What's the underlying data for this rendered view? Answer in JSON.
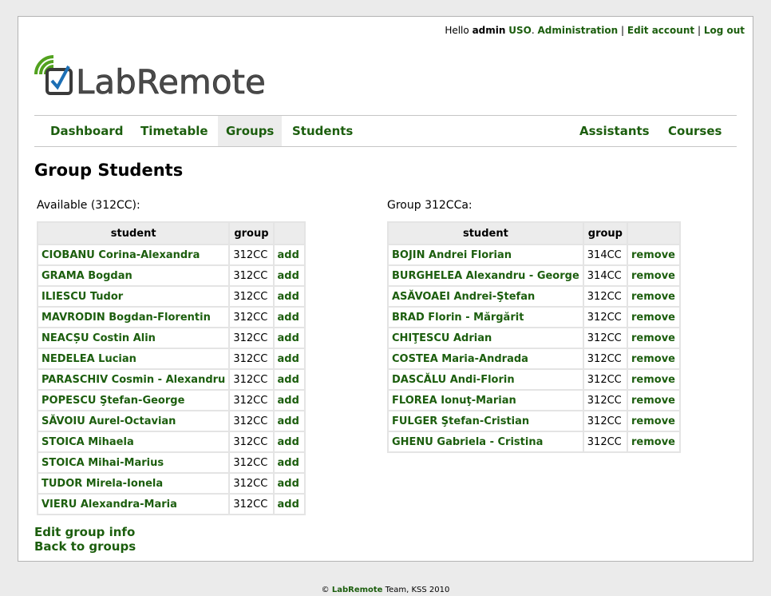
{
  "userbar": {
    "hello": "Hello",
    "username": "admin",
    "role": "USO",
    "admin_link": "Administration",
    "edit_link": "Edit account",
    "logout_link": "Log out"
  },
  "logo": {
    "text": "LabRemote"
  },
  "nav": {
    "left": [
      "Dashboard",
      "Timetable",
      "Groups",
      "Students"
    ],
    "right": [
      "Assistants",
      "Courses"
    ],
    "active": "Groups"
  },
  "page": {
    "title": "Group Students"
  },
  "available": {
    "caption": "Available (312CC):",
    "headers": [
      "student",
      "group"
    ],
    "action": "add",
    "rows": [
      [
        "CIOBANU Corina-Alexandra",
        "312CC"
      ],
      [
        "GRAMA Bogdan",
        "312CC"
      ],
      [
        "ILIESCU Tudor",
        "312CC"
      ],
      [
        "MAVRODIN Bogdan-Florentin",
        "312CC"
      ],
      [
        "NEACȘU Costin Alin",
        "312CC"
      ],
      [
        "NEDELEA Lucian",
        "312CC"
      ],
      [
        "PARASCHIV Cosmin - Alexandru",
        "312CC"
      ],
      [
        "POPESCU Ştefan-George",
        "312CC"
      ],
      [
        "SĂVOIU Aurel-Octavian",
        "312CC"
      ],
      [
        "STOICA Mihaela",
        "312CC"
      ],
      [
        "STOICA Mihai-Marius",
        "312CC"
      ],
      [
        "TUDOR Mirela-Ionela",
        "312CC"
      ],
      [
        "VIERU Alexandra-Maria",
        "312CC"
      ]
    ]
  },
  "group": {
    "caption": "Group 312CCa:",
    "headers": [
      "student",
      "group"
    ],
    "action": "remove",
    "rows": [
      [
        "BOJIN Andrei Florian",
        "314CC"
      ],
      [
        "BURGHELEA Alexandru - George",
        "314CC"
      ],
      [
        "ASĂVOAEI Andrei-Ştefan",
        "312CC"
      ],
      [
        "BRAD Florin - Mărgărit",
        "312CC"
      ],
      [
        "CHIŢESCU Adrian",
        "312CC"
      ],
      [
        "COSTEA Maria-Andrada",
        "312CC"
      ],
      [
        "DASCĂLU Andi-Florin",
        "312CC"
      ],
      [
        "FLOREA Ionuţ-Marian",
        "312CC"
      ],
      [
        "FULGER Ştefan-Cristian",
        "312CC"
      ],
      [
        "GHENU Gabriela - Cristina",
        "312CC"
      ]
    ]
  },
  "links": {
    "edit_group": "Edit group info",
    "back": "Back to groups"
  },
  "footer": {
    "copy": "©",
    "brand": "LabRemote",
    "rest": "Team, KSS 2010"
  },
  "colors": {
    "link": "#1c5e0e",
    "header_bg": "#ececec",
    "page_bg": "#ebebeb"
  }
}
